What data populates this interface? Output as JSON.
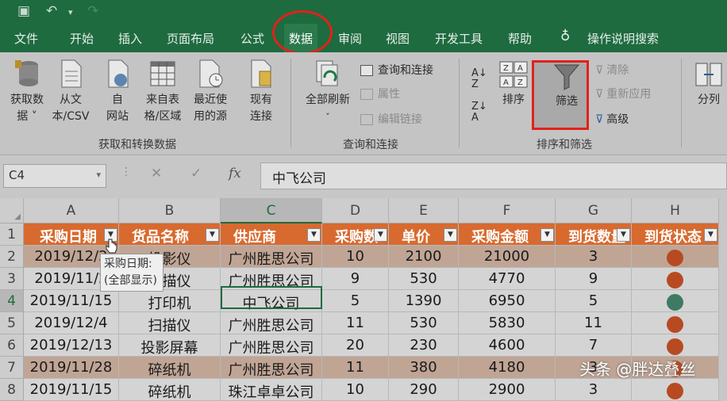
{
  "tabs": [
    "文件",
    "开始",
    "插入",
    "页面布局",
    "公式",
    "数据",
    "审阅",
    "视图",
    "开发工具",
    "帮助"
  ],
  "tell_me": "操作说明搜索",
  "ribbon": {
    "get_data_l1": "获取数",
    "get_data_l2": "据 ˅",
    "from_text_l1": "从文",
    "from_text_l2": "本/CSV",
    "from_web_l1": "自",
    "from_web_l2": "网站",
    "from_table_l1": "来自表",
    "from_table_l2": "格/区域",
    "recent_l1": "最近使",
    "recent_l2": "用的源",
    "existing_l1": "现有",
    "existing_l2": "连接",
    "group1_label": "获取和转换数据",
    "refresh_all": "全部刷新",
    "queries_connections": "查询和连接",
    "properties": "属性",
    "edit_links": "编辑链接",
    "group2_label": "查询和连接",
    "sort": "排序",
    "filter": "筛选",
    "clear": "清除",
    "reapply": "重新应用",
    "advanced": "高级",
    "group3_label": "排序和筛选",
    "text_to_columns": "分列"
  },
  "formula": {
    "name_box": "C4",
    "fx": "fx",
    "content": "中飞公司"
  },
  "columns": [
    "A",
    "B",
    "C",
    "D",
    "E",
    "F",
    "G",
    "H"
  ],
  "rows": [
    "1",
    "2",
    "3",
    "4",
    "5",
    "6",
    "7",
    "8"
  ],
  "headers": [
    "采购日期",
    "货品名称",
    "供应商",
    "采购数",
    "单价",
    "采购金额",
    "到货数量",
    "到货状态"
  ],
  "data": [
    [
      "2019/12/2",
      "投影仪",
      "广州胜思公司",
      "10",
      "2100",
      "21000",
      "3",
      "red"
    ],
    [
      "2019/11/2",
      "扫描仪",
      "广州胜思公司",
      "9",
      "530",
      "4770",
      "9",
      "red"
    ],
    [
      "2019/11/15",
      "打印机",
      "中飞公司",
      "5",
      "1390",
      "6950",
      "5",
      "green"
    ],
    [
      "2019/12/4",
      "扫描仪",
      "广州胜思公司",
      "11",
      "530",
      "5830",
      "11",
      "red"
    ],
    [
      "2019/12/13",
      "投影屏幕",
      "广州胜思公司",
      "20",
      "230",
      "4600",
      "7",
      "red"
    ],
    [
      "2019/11/28",
      "碎纸机",
      "广州胜思公司",
      "11",
      "380",
      "4180",
      "3",
      "red"
    ],
    [
      "2019/11/15",
      "碎纸机",
      "珠江卓卓公司",
      "10",
      "290",
      "2900",
      "3",
      "red"
    ]
  ],
  "tooltip": {
    "line1": "采购日期:",
    "line2": "(全部显示)"
  },
  "watermark": "头条 @胖达叠丝",
  "colors": {
    "excel_green": "#1e6b40",
    "header_orange": "#d86a2f",
    "status_red": "#b84a22",
    "status_green": "#3f7a64",
    "highlight_red": "#e3211b"
  }
}
